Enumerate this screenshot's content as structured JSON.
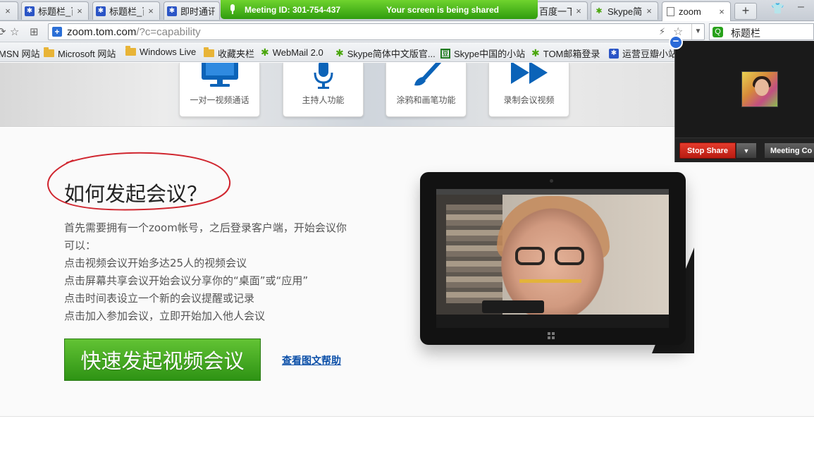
{
  "tabs": [
    {
      "label": "标题栏_百",
      "icon": "baidu-paw-icon"
    },
    {
      "label": "标题栏_百",
      "icon": "baidu-paw-icon"
    },
    {
      "label": "即时通讯",
      "icon": "baidu-paw-icon"
    },
    {
      "label": "百度一下",
      "icon": "baidu-paw-icon"
    },
    {
      "label": "Skype简体",
      "icon": "skype-leaf-icon"
    },
    {
      "label": "zoom",
      "icon": "page-icon"
    }
  ],
  "new_tab_label": "+",
  "meeting_banner": {
    "meeting_id": "Meeting ID: 301-754-437",
    "status": "Your screen is being shared"
  },
  "address": {
    "host": "zoom.tom.com",
    "path": "/?c=capability"
  },
  "search_engine_label": "标题栏",
  "bookmarks": [
    {
      "label": "MSN 网站",
      "icon": "msn-icon"
    },
    {
      "label": "Microsoft 网站",
      "icon": "folder-icon"
    },
    {
      "label": "Windows Live",
      "icon": "folder-icon"
    },
    {
      "label": "收藏夹栏",
      "icon": "folder-icon"
    },
    {
      "label": "WebMail 2.0",
      "icon": "skype-leaf-icon"
    },
    {
      "label": "Skype简体中文版官...",
      "icon": "skype-leaf-icon"
    },
    {
      "label": "Skype中国的小站",
      "icon": "douban-icon"
    },
    {
      "label": "TOM邮箱登录",
      "icon": "skype-leaf-icon"
    },
    {
      "label": "运营豆瓣小站",
      "icon": "baidu-paw-icon"
    }
  ],
  "features": [
    {
      "label": "一对一视频通话",
      "icon": "monitor-icon"
    },
    {
      "label": "主持人功能",
      "icon": "microphone-icon"
    },
    {
      "label": "涂鸦和画笔功能",
      "icon": "paintbrush-icon"
    },
    {
      "label": "录制会议视频",
      "icon": "fast-forward-icon"
    }
  ],
  "main": {
    "heading": "如何发起会议？",
    "desc_lines": [
      "首先需要拥有一个zoom帐号，之后登录客户端，开始会议你",
      "可以：",
      "点击视频会议开始多达25人的视频会议",
      "点击屏幕共享会议开始会议分享你的“桌面”或“应用”",
      "点击时间表设立一个新的会议提醒或记录",
      "点击加入参加会议，立即开始加入他人会议"
    ],
    "start_button": "快速发起视频会议",
    "help_link": "查看图文帮助"
  },
  "zoom_panel": {
    "stop_share": "Stop Share",
    "meeting_controls": "Meeting Co"
  },
  "colors": {
    "banner_green": "#3fae14",
    "button_green": "#3fa41f",
    "stop_red": "#d42a1e",
    "link_blue": "#0b4fa8",
    "circle_red": "#d0262f"
  }
}
